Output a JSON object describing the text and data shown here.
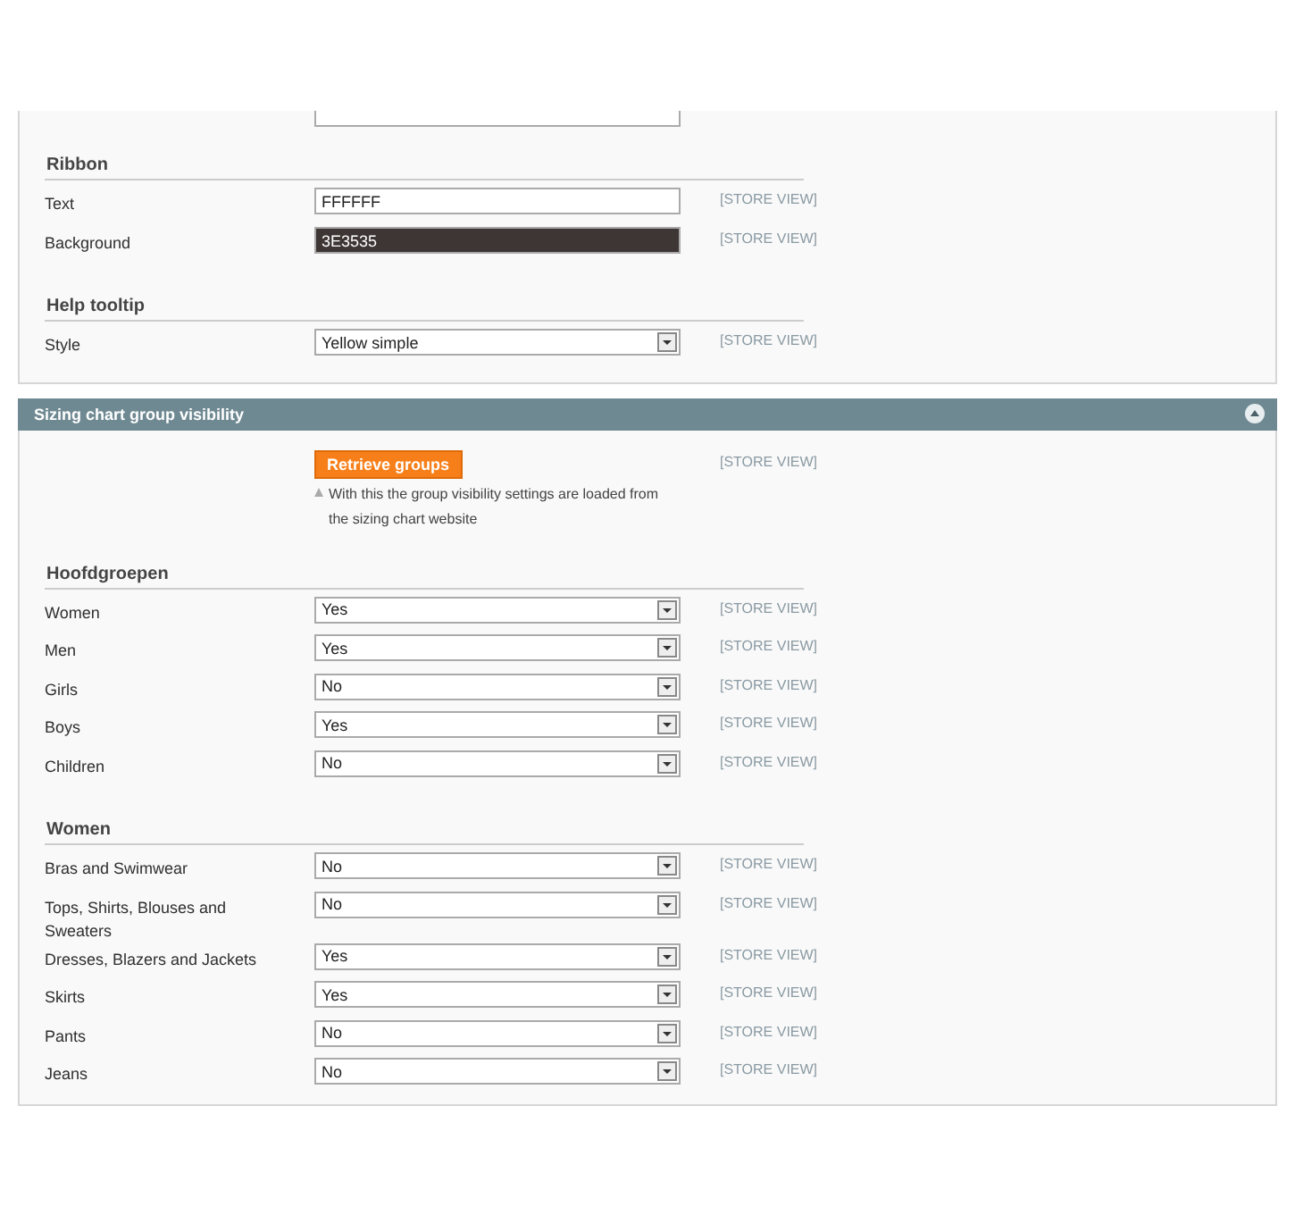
{
  "settings_panel": {
    "groups": [
      {
        "title": "Ribbon",
        "rows": [
          {
            "label": "Text",
            "kind": "text",
            "value": "FFFFFF",
            "scope": "[STORE VIEW]"
          },
          {
            "label": "Background",
            "kind": "color",
            "value": "3E3535",
            "scope": "[STORE VIEW]"
          }
        ]
      },
      {
        "title": "Help tooltip",
        "rows": [
          {
            "label": "Style",
            "kind": "select",
            "value": "Yellow simple",
            "scope": "[STORE VIEW]"
          }
        ]
      }
    ]
  },
  "visibility_panel": {
    "title": "Sizing chart group visibility",
    "expanded": true,
    "retrieve": {
      "button": "Retrieve groups",
      "note": "With this the group visibility settings are loaded from the sizing chart website",
      "scope": "[STORE VIEW]"
    },
    "groups": [
      {
        "title": "Hoofdgroepen",
        "rows": [
          {
            "label": "Women",
            "kind": "select",
            "value": "Yes",
            "scope": "[STORE VIEW]"
          },
          {
            "label": "Men",
            "kind": "select",
            "value": "Yes",
            "scope": "[STORE VIEW]"
          },
          {
            "label": "Girls",
            "kind": "select",
            "value": "No",
            "scope": "[STORE VIEW]"
          },
          {
            "label": "Boys",
            "kind": "select",
            "value": "Yes",
            "scope": "[STORE VIEW]"
          },
          {
            "label": "Children",
            "kind": "select",
            "value": "No",
            "scope": "[STORE VIEW]"
          }
        ]
      },
      {
        "title": "Women",
        "rows": [
          {
            "label": "Bras and Swimwear",
            "kind": "select",
            "value": "No",
            "scope": "[STORE VIEW]"
          },
          {
            "label": "Tops, Shirts, Blouses and Sweaters",
            "kind": "select",
            "value": "No",
            "scope": "[STORE VIEW]"
          },
          {
            "label": "Dresses, Blazers and Jackets",
            "kind": "select",
            "value": "Yes",
            "scope": "[STORE VIEW]"
          },
          {
            "label": "Skirts",
            "kind": "select",
            "value": "Yes",
            "scope": "[STORE VIEW]"
          },
          {
            "label": "Pants",
            "kind": "select",
            "value": "No",
            "scope": "[STORE VIEW]"
          },
          {
            "label": "Jeans",
            "kind": "select",
            "value": "No",
            "scope": "[STORE VIEW]"
          }
        ]
      }
    ]
  }
}
